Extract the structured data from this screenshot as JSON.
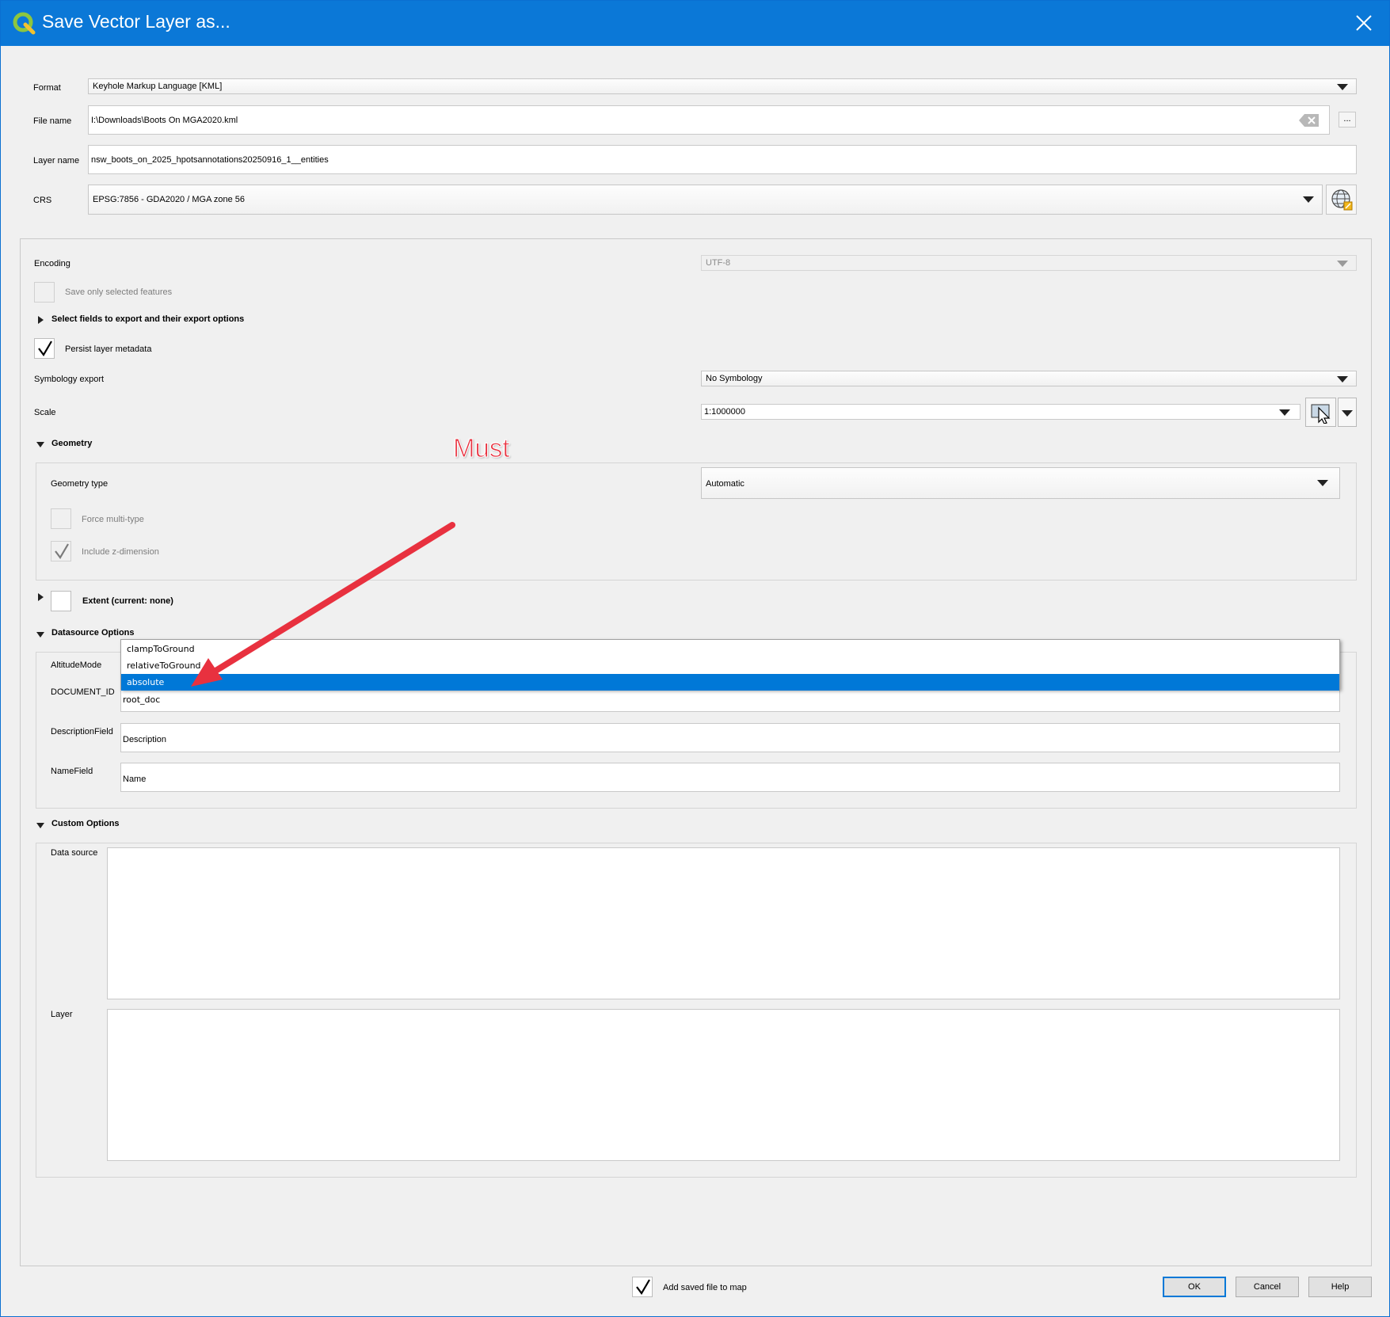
{
  "window": {
    "title": "Save Vector Layer as...",
    "title_bar_color": "#0b78d7",
    "accent_color": "#0078d7",
    "icons": [
      "qgis-logo-icon",
      "close-icon"
    ]
  },
  "format": {
    "label": "Format",
    "value": "Keyhole Markup Language [KML]"
  },
  "file_name": {
    "label": "File name",
    "value": "I:\\Downloads\\Boots On MGA2020.kml",
    "browse_label": "..."
  },
  "layer_name": {
    "label": "Layer name",
    "value": "nsw_boots_on_2025_hpotsannotations20250916_1__entities"
  },
  "crs": {
    "label": "CRS",
    "value": "EPSG:7856 - GDA2020 / MGA zone 56"
  },
  "encoding": {
    "label": "Encoding",
    "value": "UTF-8"
  },
  "save_only_selected": {
    "label": "Save only selected features",
    "checked": false
  },
  "select_fields": {
    "label": "Select fields to export and their export options",
    "expanded": false
  },
  "persist_metadata": {
    "label": "Persist layer metadata",
    "checked": true
  },
  "symbology_export": {
    "label": "Symbology export",
    "value": "No Symbology"
  },
  "scale": {
    "label": "Scale",
    "value": "1:1000000"
  },
  "geometry": {
    "header": "Geometry",
    "type_label": "Geometry type",
    "type_value": "Automatic",
    "force_multi_label": "Force multi-type",
    "force_multi_checked": false,
    "include_z_label": "Include z-dimension",
    "include_z_checked": true
  },
  "extent": {
    "label": "Extent (current: none)",
    "checked": false
  },
  "datasource_options": {
    "header": "Datasource Options",
    "altitude_mode_label": "AltitudeMode",
    "altitude_mode_options": [
      "clampToGround",
      "relativeToGround",
      "absolute"
    ],
    "altitude_mode_selected": "absolute",
    "document_id_label": "DOCUMENT_ID",
    "document_id_value": "root_doc",
    "description_field_label": "DescriptionField",
    "description_field_value": "Description",
    "name_field_label": "NameField",
    "name_field_value": "Name"
  },
  "custom_options": {
    "header": "Custom Options",
    "data_source_label": "Data source",
    "data_source_value": "",
    "layer_label": "Layer",
    "layer_value": ""
  },
  "annotation": {
    "text": "Must",
    "color": "#e8313f"
  },
  "footer": {
    "add_saved_label": "Add saved file to map",
    "add_saved_checked": true,
    "ok_label": "OK",
    "cancel_label": "Cancel",
    "help_label": "Help"
  }
}
